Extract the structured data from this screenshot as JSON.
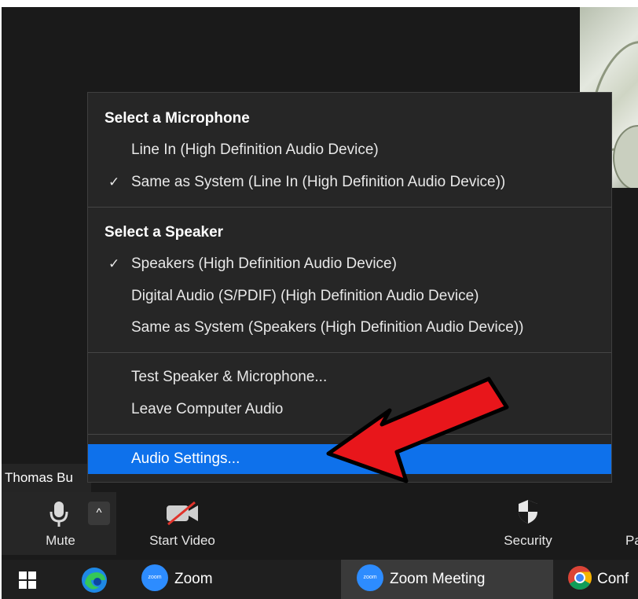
{
  "participant": {
    "name": "Thomas Bu"
  },
  "audio_menu": {
    "microphone_header": "Select a Microphone",
    "microphones": [
      {
        "label": "Line In (High Definition Audio Device)",
        "checked": false
      },
      {
        "label": "Same as System (Line In (High Definition Audio Device))",
        "checked": true
      }
    ],
    "speaker_header": "Select a Speaker",
    "speakers": [
      {
        "label": "Speakers (High Definition Audio Device)",
        "checked": true
      },
      {
        "label": "Digital Audio (S/PDIF) (High Definition Audio Device)",
        "checked": false
      },
      {
        "label": "Same as System (Speakers (High Definition Audio Device))",
        "checked": false
      }
    ],
    "check_glyph": "✓",
    "test_label": "Test Speaker & Microphone...",
    "leave_label": "Leave Computer Audio",
    "settings_label": "Audio Settings...",
    "highlight_color": "#0e71eb"
  },
  "annotation": {
    "arrow_color": "#e8161b",
    "arrow_icon": "red-arrow-icon"
  },
  "toolbar": {
    "mute_label": "Mute",
    "start_video_label": "Start Video",
    "security_label": "Security",
    "participants_label_partial": "Pa",
    "caret_glyph": "^"
  },
  "taskbar": {
    "zoom_label": "Zoom",
    "zoom_meeting_label": "Zoom Meeting",
    "chrome_partial_label": "Conf",
    "zoom_logo_text": "zoom"
  }
}
